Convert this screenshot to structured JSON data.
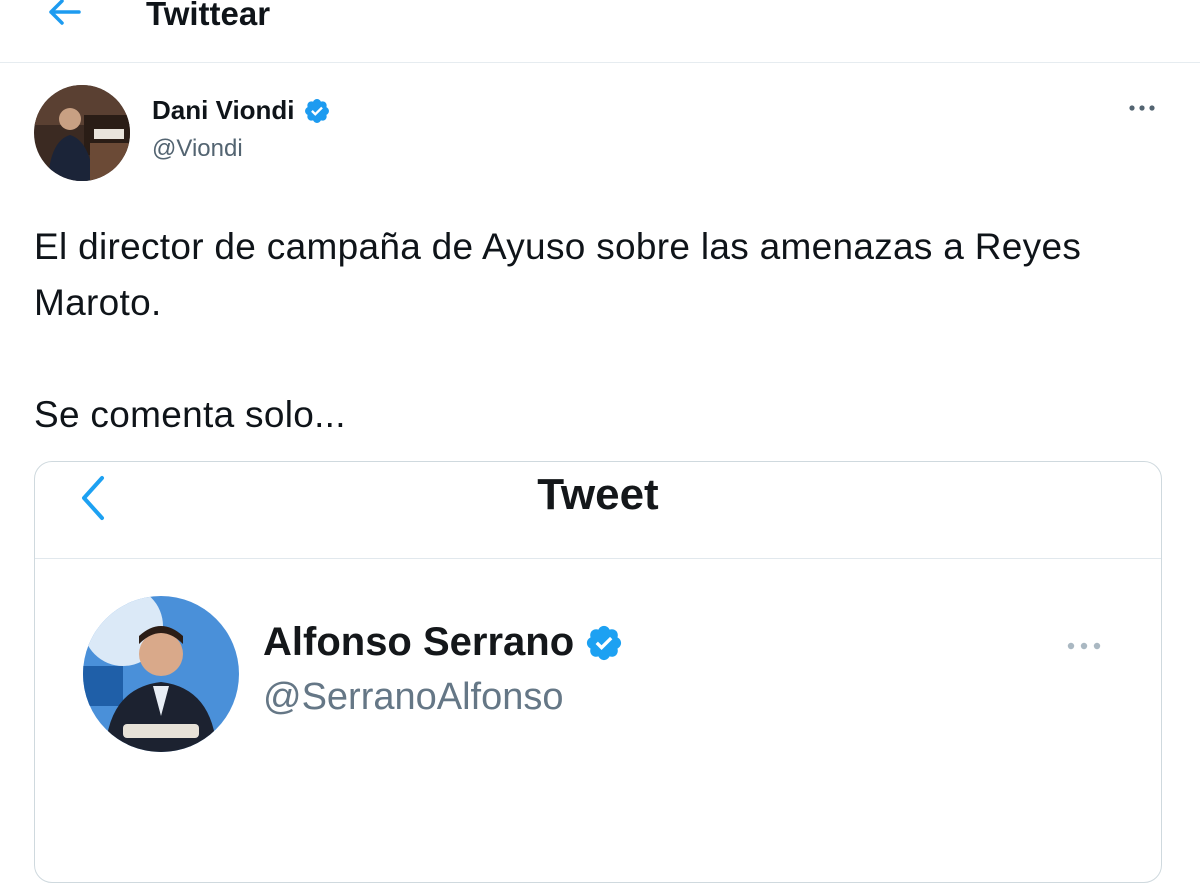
{
  "header": {
    "title": "Twittear",
    "back_icon": "arrow-left-icon"
  },
  "tweet": {
    "author_name": "Dani Viondi",
    "handle": "@Viondi",
    "verified_icon": "verified-badge-icon",
    "more_icon": "more-horizontal-icon",
    "text_paragraphs": [
      "El director de campaña de Ayuso sobre las amenazas a Reyes Maroto.",
      "Se comenta solo..."
    ]
  },
  "embedded_screenshot": {
    "title": "Tweet",
    "back_icon": "chevron-left-icon",
    "author_name": "Alfonso Serrano",
    "handle": "@SerranoAlfonso",
    "verified_icon": "verified-badge-icon",
    "more_icon": "more-horizontal-icon"
  },
  "colors": {
    "accent": "#1d9bf0",
    "text": "#0f1419",
    "secondary_text": "#536471",
    "border": "#e6ecf0"
  }
}
